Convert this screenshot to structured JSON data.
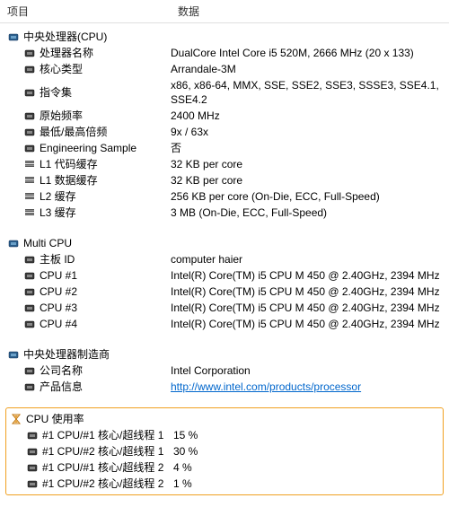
{
  "columns": {
    "item": "项目",
    "data": "数据"
  },
  "cpu": {
    "title": "中央处理器(CPU)",
    "rows": [
      {
        "label": "处理器名称",
        "value": "DualCore Intel Core i5 520M, 2666 MHz (20 x 133)",
        "icon": "chip"
      },
      {
        "label": "核心类型",
        "value": "Arrandale-3M",
        "icon": "chip"
      },
      {
        "label": "指令集",
        "value": "x86, x86-64, MMX, SSE, SSE2, SSE3, SSSE3, SSE4.1, SSE4.2",
        "icon": "chip"
      },
      {
        "label": "原始频率",
        "value": "2400 MHz",
        "icon": "chip"
      },
      {
        "label": "最低/最高倍频",
        "value": "9x / 63x",
        "icon": "chip"
      },
      {
        "label": "Engineering Sample",
        "value": "否",
        "icon": "chip"
      },
      {
        "label": "L1 代码缓存",
        "value": "32 KB per core",
        "icon": "cache"
      },
      {
        "label": "L1 数据缓存",
        "value": "32 KB per core",
        "icon": "cache"
      },
      {
        "label": "L2 缓存",
        "value": "256 KB per core  (On-Die, ECC, Full-Speed)",
        "icon": "cache"
      },
      {
        "label": "L3 缓存",
        "value": "3 MB  (On-Die, ECC, Full-Speed)",
        "icon": "cache"
      }
    ]
  },
  "multi": {
    "title": "Multi CPU",
    "rows": [
      {
        "label": "主板 ID",
        "value": "computer haier",
        "icon": "chip"
      },
      {
        "label": "CPU #1",
        "value": "Intel(R) Core(TM) i5 CPU M 450 @ 2.40GHz, 2394 MHz",
        "icon": "chip"
      },
      {
        "label": "CPU #2",
        "value": "Intel(R) Core(TM) i5 CPU M 450 @ 2.40GHz, 2394 MHz",
        "icon": "chip"
      },
      {
        "label": "CPU #3",
        "value": "Intel(R) Core(TM) i5 CPU M 450 @ 2.40GHz, 2394 MHz",
        "icon": "chip"
      },
      {
        "label": "CPU #4",
        "value": "Intel(R) Core(TM) i5 CPU M 450 @ 2.40GHz, 2394 MHz",
        "icon": "chip"
      }
    ]
  },
  "maker": {
    "title": "中央处理器制造商",
    "rows": [
      {
        "label": "公司名称",
        "value": "Intel Corporation",
        "icon": "chip"
      },
      {
        "label": "产品信息",
        "value": "http://www.intel.com/products/processor",
        "icon": "chip",
        "link": true
      }
    ]
  },
  "usage": {
    "title": "CPU 使用率",
    "rows": [
      {
        "label": "#1 CPU/#1 核心/超线程 1",
        "value": "15 %",
        "icon": "chip"
      },
      {
        "label": "#1 CPU/#2 核心/超线程 1",
        "value": "30 %",
        "icon": "chip"
      },
      {
        "label": "#1 CPU/#1 核心/超线程 2",
        "value": "4 %",
        "icon": "chip"
      },
      {
        "label": "#1 CPU/#2 核心/超线程 2",
        "value": "1 %",
        "icon": "chip"
      }
    ]
  }
}
